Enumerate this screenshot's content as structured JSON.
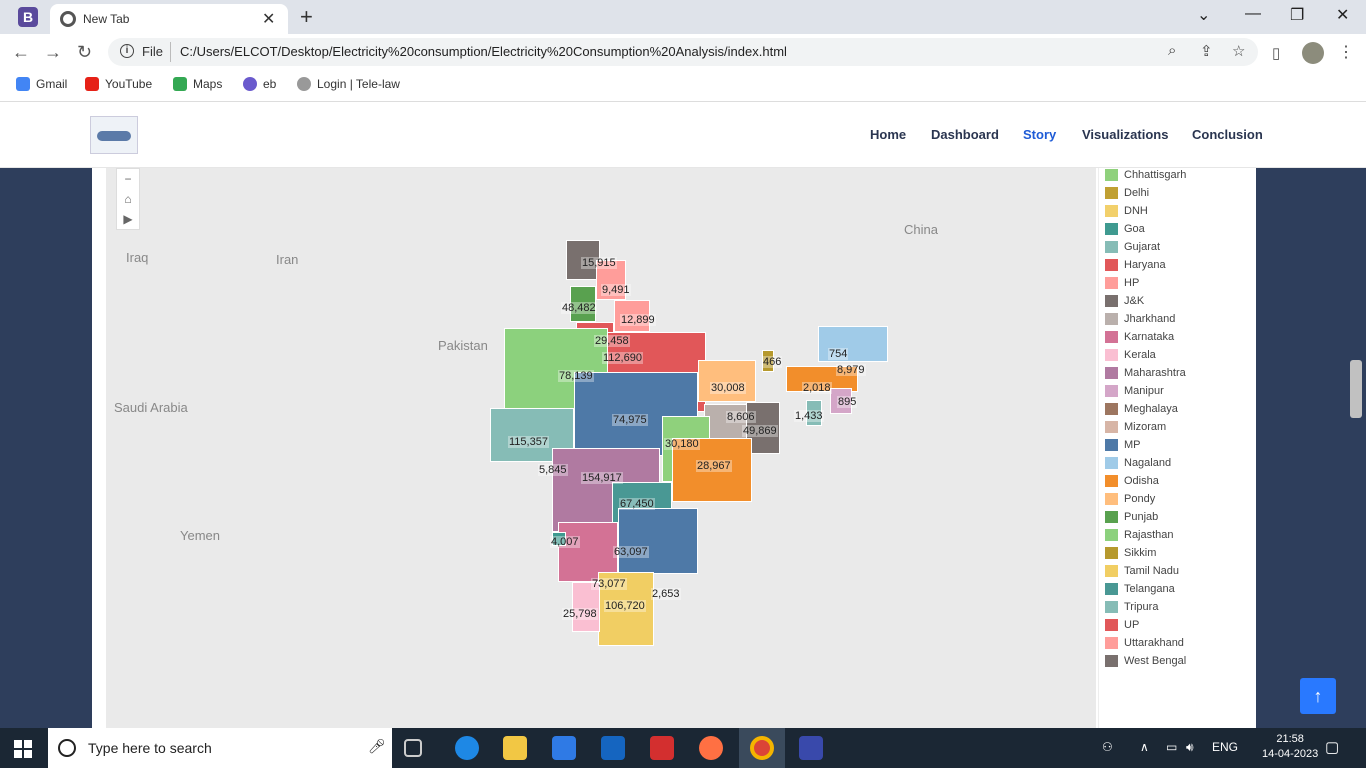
{
  "browser": {
    "tab_title": "New Tab",
    "tab_favicon_letter": "B",
    "address_scheme": "File",
    "url": "C:/Users/ELCOT/Desktop/Electricity%20consumption/Electricity%20Consumption%20Analysis/index.html",
    "bookmarks": [
      {
        "label": "Gmail",
        "color": "#4285f4"
      },
      {
        "label": "YouTube",
        "color": "#e62117"
      },
      {
        "label": "Maps",
        "color": "#34a853"
      },
      {
        "label": "eb",
        "color": "#6a5acd"
      },
      {
        "label": "Login | Tele-law",
        "color": "#999999"
      }
    ]
  },
  "site": {
    "nav": [
      "Home",
      "Dashboard",
      "Story",
      "Visualizations",
      "Conclusion"
    ],
    "active_nav": "Story",
    "active_color": "#1e5bd6"
  },
  "map": {
    "countries": [
      "Iraq",
      "Iran",
      "Pakistan",
      "Saudi Arabia",
      "Yemen",
      "China"
    ],
    "legend": [
      {
        "name": "Chhattisgarh",
        "color": "#8fd17c"
      },
      {
        "name": "Delhi",
        "color": "#c0a032"
      },
      {
        "name": "DNH",
        "color": "#f2d06b"
      },
      {
        "name": "Goa",
        "color": "#3f9a90"
      },
      {
        "name": "Gujarat",
        "color": "#86bcb6"
      },
      {
        "name": "Haryana",
        "color": "#e15759"
      },
      {
        "name": "HP",
        "color": "#ff9d9a"
      },
      {
        "name": "J&K",
        "color": "#79706e"
      },
      {
        "name": "Jharkhand",
        "color": "#bab0ac"
      },
      {
        "name": "Karnataka",
        "color": "#d37295"
      },
      {
        "name": "Kerala",
        "color": "#fabfd2"
      },
      {
        "name": "Maharashtra",
        "color": "#b07aa1"
      },
      {
        "name": "Manipur",
        "color": "#d4a6c8"
      },
      {
        "name": "Meghalaya",
        "color": "#9d7660"
      },
      {
        "name": "Mizoram",
        "color": "#d7b5a6"
      },
      {
        "name": "MP",
        "color": "#4e79a7"
      },
      {
        "name": "Nagaland",
        "color": "#a0cbe8"
      },
      {
        "name": "Odisha",
        "color": "#f28e2b"
      },
      {
        "name": "Pondy",
        "color": "#ffbe7d"
      },
      {
        "name": "Punjab",
        "color": "#59a14f"
      },
      {
        "name": "Rajasthan",
        "color": "#8cd17d"
      },
      {
        "name": "Sikkim",
        "color": "#b6992d"
      },
      {
        "name": "Tamil Nadu",
        "color": "#f1ce63"
      },
      {
        "name": "Telangana",
        "color": "#499894"
      },
      {
        "name": "Tripura",
        "color": "#86bcb6"
      },
      {
        "name": "UP",
        "color": "#e15759"
      },
      {
        "name": "Uttarakhand",
        "color": "#ff9d9a"
      },
      {
        "name": "West Bengal",
        "color": "#79706e"
      }
    ],
    "values": [
      {
        "state": "J&K",
        "label": "15,915"
      },
      {
        "state": "HP",
        "label": "9,491"
      },
      {
        "state": "Punjab",
        "label": "48,482"
      },
      {
        "state": "Uttarakhand",
        "label": "12,899"
      },
      {
        "state": "Haryana",
        "label": "29,458"
      },
      {
        "state": "UP",
        "label": "112,690"
      },
      {
        "state": "Rajasthan",
        "label": "78,139"
      },
      {
        "state": "Bihar",
        "label": "30,008"
      },
      {
        "state": "Sikkim",
        "label": "466"
      },
      {
        "state": "Nagaland",
        "label": "754"
      },
      {
        "state": "Assam",
        "label": "8,979"
      },
      {
        "state": "Meghalaya",
        "label": "2,018"
      },
      {
        "state": "Manipur",
        "label": "895"
      },
      {
        "state": "Tripura",
        "label": "1,433"
      },
      {
        "state": "MP",
        "label": "74,975"
      },
      {
        "state": "Jharkhand",
        "label": "8,606"
      },
      {
        "state": "West Bengal",
        "label": "49,869"
      },
      {
        "state": "Gujarat",
        "label": "115,357"
      },
      {
        "state": "Chhattisgarh",
        "label": "30,180"
      },
      {
        "state": "DNH",
        "label": "5,845"
      },
      {
        "state": "Odisha",
        "label": "28,967"
      },
      {
        "state": "Maharashtra",
        "label": "154,917"
      },
      {
        "state": "Telangana",
        "label": "67,450"
      },
      {
        "state": "Goa",
        "label": "4,007"
      },
      {
        "state": "Andhra",
        "label": "63,097"
      },
      {
        "state": "Karnataka",
        "label": "73,077"
      },
      {
        "state": "Pondy",
        "label": "2,653"
      },
      {
        "state": "Tamil Nadu",
        "label": "106,720"
      },
      {
        "state": "Kerala",
        "label": "25,798"
      }
    ]
  },
  "taskbar": {
    "search_placeholder": "Type here to search",
    "language": "ENG",
    "time": "21:58",
    "date": "14-04-2023"
  }
}
